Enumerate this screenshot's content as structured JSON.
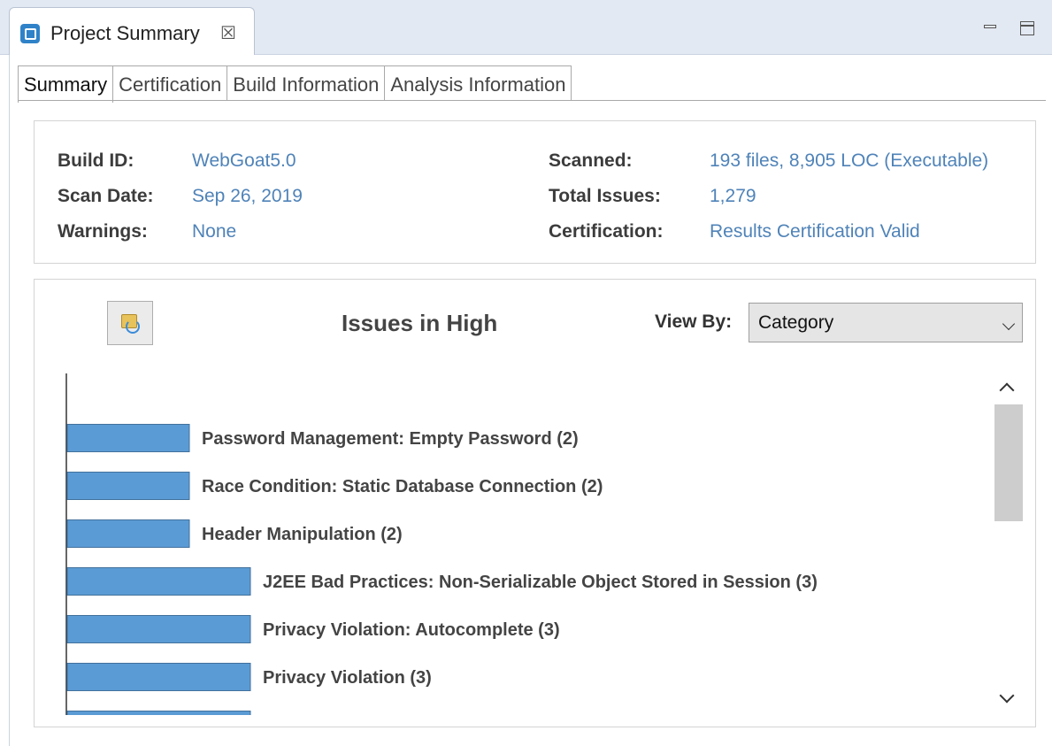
{
  "view_tab": {
    "title": "Project Summary",
    "close_glyph": "☒",
    "icon": "project-summary-icon"
  },
  "window_controls": {
    "minimize_icon": "minimize-icon",
    "maximize_icon": "maximize-icon"
  },
  "subtabs": [
    {
      "label": "Summary",
      "active": true
    },
    {
      "label": "Certification",
      "active": false
    },
    {
      "label": "Build Information",
      "active": false
    },
    {
      "label": "Analysis Information",
      "active": false
    }
  ],
  "summary": {
    "build_id_label": "Build ID:",
    "build_id": "WebGoat5.0",
    "scan_date_label": "Scan Date:",
    "scan_date": "Sep 26, 2019",
    "warnings_label": "Warnings:",
    "warnings": "None",
    "scanned_label": "Scanned:",
    "scanned": "193 files, 8,905 LOC (Executable)",
    "total_issues_label": "Total Issues:",
    "total_issues": "1,279",
    "certification_label": "Certification:",
    "certification": "Results Certification Valid"
  },
  "chart_controls": {
    "refresh_icon": "refresh-icon",
    "title": "Issues in High",
    "view_by_label": "View By:",
    "view_by_value": "Category"
  },
  "colors": {
    "bar": "#5b9bd5",
    "bar_border": "#41719c",
    "value_text": "#4f83b8"
  },
  "chart_data": {
    "type": "bar",
    "orientation": "horizontal",
    "title": "Issues in High",
    "categories": [
      "Password Management: Empty Password (2)",
      "Race Condition: Static Database Connection (2)",
      "Header Manipulation (2)",
      "J2EE Bad Practices: Non-Serializable Object Stored in Session (3)",
      "Privacy Violation: Autocomplete (3)",
      "Privacy Violation (3)"
    ],
    "values": [
      2,
      2,
      2,
      3,
      3,
      3
    ],
    "partially_visible_next_value": 3,
    "grid": false
  }
}
